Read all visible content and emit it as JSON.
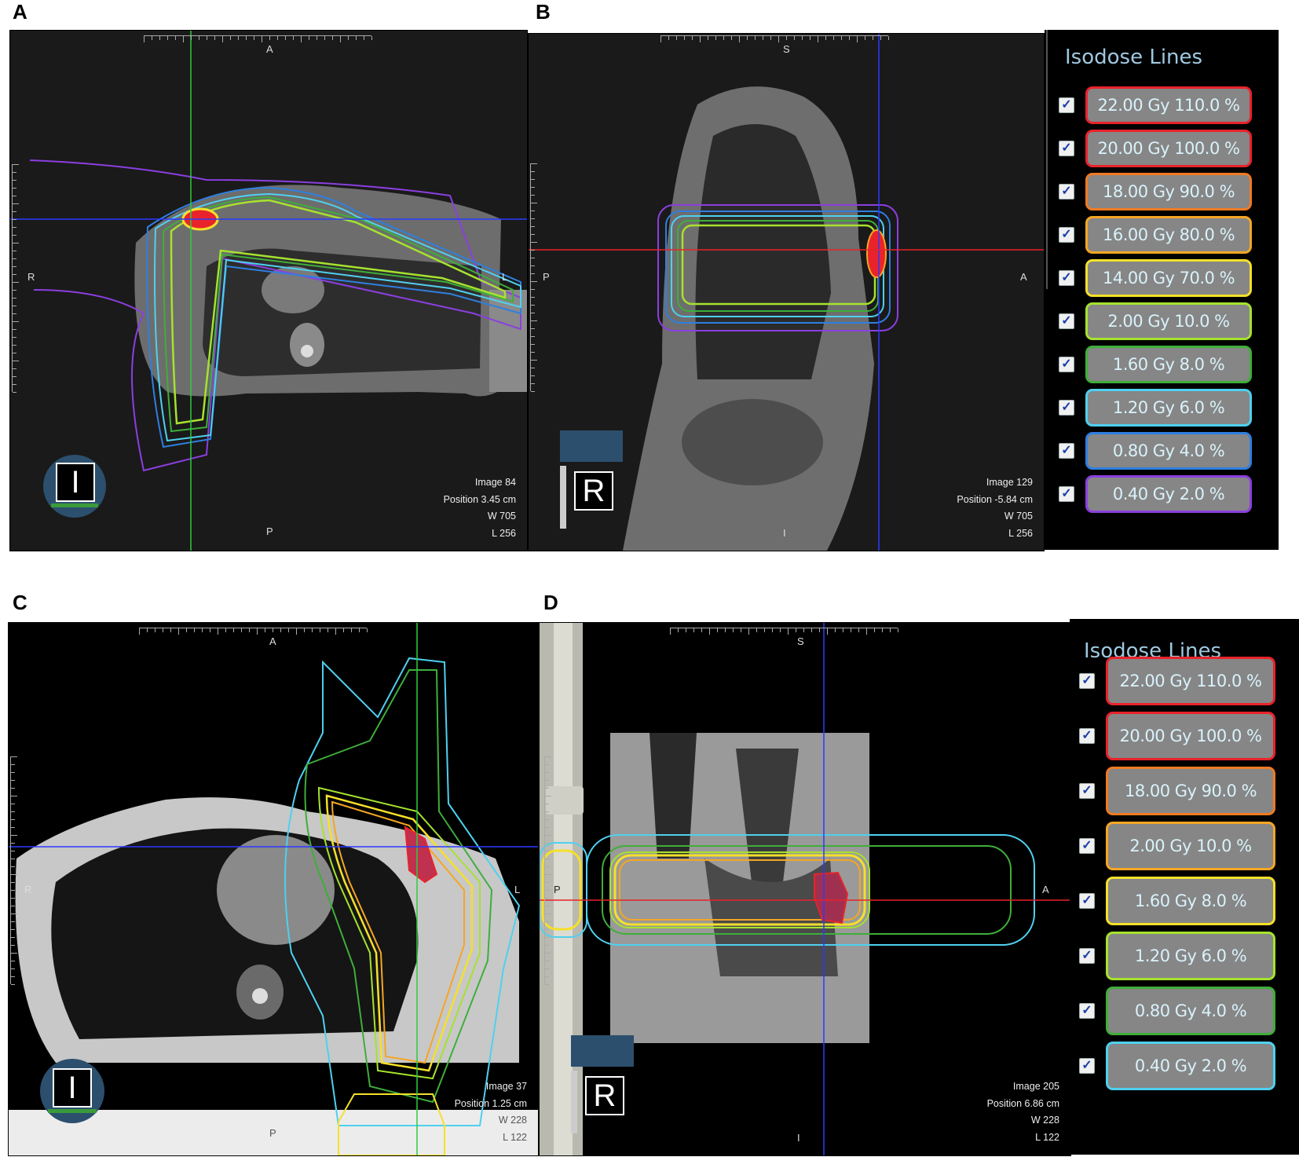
{
  "figure_labels": {
    "a": "A",
    "b": "B",
    "c": "C",
    "d": "D"
  },
  "panel_a": {
    "orientation": {
      "top": "A",
      "bottom": "P",
      "left": "R",
      "right": "L"
    },
    "view_badge": "I",
    "info": {
      "image": "Image  84",
      "position": "Position  3.45 cm",
      "w": "W  705",
      "l": "L  256"
    }
  },
  "panel_b": {
    "orientation": {
      "top": "S",
      "bottom": "I",
      "left": "P",
      "right": "A"
    },
    "view_badge": "R",
    "info": {
      "image": "Image  129",
      "position": "Position  -5.84 cm",
      "w": "W  705",
      "l": "L  256"
    }
  },
  "legend_top": {
    "title": "Isodose Lines",
    "items": [
      {
        "label": "22.00 Gy  110.0 %",
        "color": "#e8232b",
        "checked": true
      },
      {
        "label": "20.00 Gy  100.0 %",
        "color": "#e8232b",
        "checked": true
      },
      {
        "label": "18.00 Gy  90.0 %",
        "color": "#f07a22",
        "checked": true
      },
      {
        "label": "16.00 Gy  80.0 %",
        "color": "#f5a623",
        "checked": true
      },
      {
        "label": "14.00 Gy  70.0 %",
        "color": "#f5e02a",
        "checked": true
      },
      {
        "label": "2.00 Gy  10.0 %",
        "color": "#a6e22e",
        "checked": true
      },
      {
        "label": "1.60 Gy  8.0 %",
        "color": "#3fae3a",
        "checked": true
      },
      {
        "label": "1.20 Gy  6.0 %",
        "color": "#4fd0ef",
        "checked": true
      },
      {
        "label": "0.80 Gy  4.0 %",
        "color": "#2f7fe0",
        "checked": true
      },
      {
        "label": "0.40 Gy  2.0 %",
        "color": "#8b3fe0",
        "checked": true
      }
    ]
  },
  "panel_c": {
    "orientation": {
      "top": "A",
      "bottom": "P",
      "left": "R",
      "right": "L"
    },
    "view_badge": "I",
    "info": {
      "image": "Image  37",
      "position": "Position  1.25 cm",
      "w": "W  228",
      "l": "L  122"
    }
  },
  "panel_d": {
    "orientation": {
      "top": "S",
      "bottom": "I",
      "left": "P",
      "right": "A"
    },
    "view_badge": "R",
    "info": {
      "image": "Image  205",
      "position": "Position  6.86 cm",
      "w": "W  228",
      "l": "L  122"
    }
  },
  "legend_bottom": {
    "title": "Isodose Lines",
    "items": [
      {
        "label": "22.00 Gy  110.0 %",
        "color": "#e8232b",
        "checked": true
      },
      {
        "label": "20.00 Gy  100.0 %",
        "color": "#e8232b",
        "checked": true
      },
      {
        "label": "18.00 Gy  90.0 %",
        "color": "#f07a22",
        "checked": true
      },
      {
        "label": "2.00 Gy  10.0 %",
        "color": "#f5a623",
        "checked": true
      },
      {
        "label": "1.60 Gy  8.0 %",
        "color": "#f5e02a",
        "checked": true
      },
      {
        "label": "1.20 Gy  6.0 %",
        "color": "#a6e22e",
        "checked": true
      },
      {
        "label": "0.80 Gy  4.0 %",
        "color": "#3fae3a",
        "checked": true
      },
      {
        "label": "0.40 Gy  2.0 %",
        "color": "#4fd0ef",
        "checked": true
      }
    ]
  }
}
